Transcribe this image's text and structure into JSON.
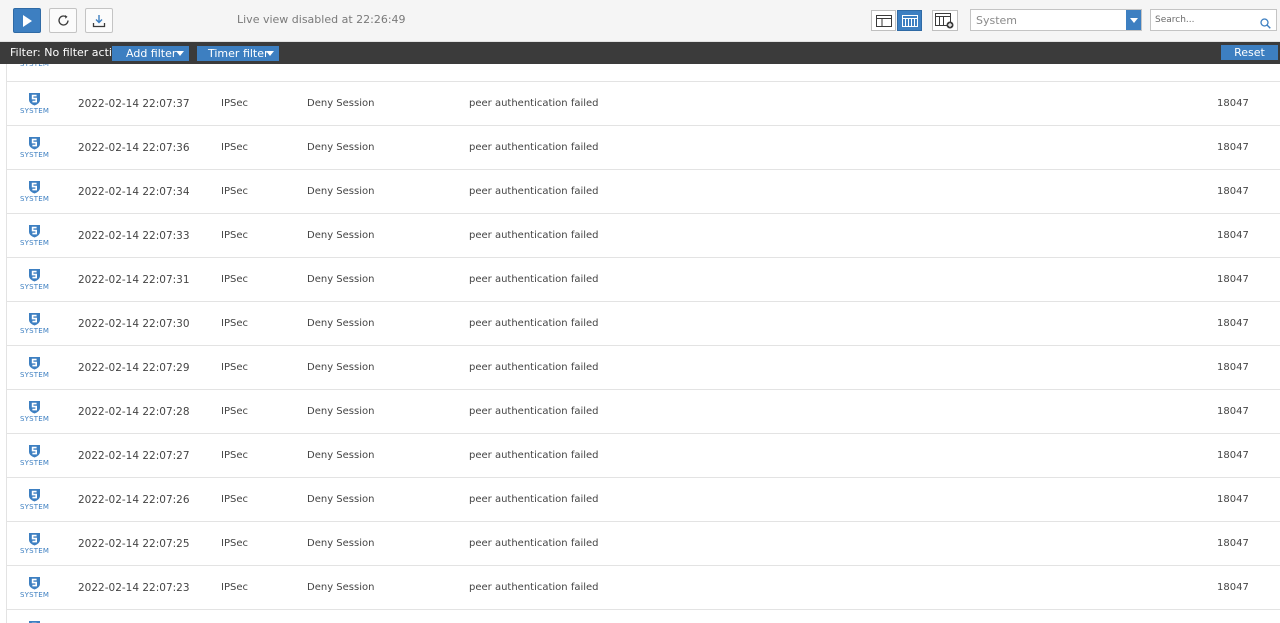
{
  "toolbar": {
    "live_status": "Live view disabled at 22:26:49",
    "icons": {
      "play": "play-icon",
      "refresh": "refresh-icon",
      "download": "download-icon",
      "view_detail": "detail-view-icon",
      "view_grid": "grid-view-icon",
      "column_settings": "column-settings-icon",
      "search": "search-icon"
    },
    "selector": {
      "value": "System"
    },
    "search": {
      "placeholder": "Search..."
    }
  },
  "filterbar": {
    "status": "Filter: No filter active",
    "add_filter": "Add filter",
    "timer_filter": "Timer filter",
    "reset": "Reset"
  },
  "colors": {
    "accent": "#3d7fc1",
    "filterbar_bg": "#3b3b3b"
  },
  "logs": {
    "type_icon": "system-shield-icon",
    "rows": [
      {
        "type": "SYSTEM",
        "time": "2022-02-14 22:07:37",
        "component": "IPSec",
        "action": "Deny Session",
        "message": "peer authentication failed",
        "id": "18047"
      },
      {
        "type": "SYSTEM",
        "time": "2022-02-14 22:07:36",
        "component": "IPSec",
        "action": "Deny Session",
        "message": "peer authentication failed",
        "id": "18047"
      },
      {
        "type": "SYSTEM",
        "time": "2022-02-14 22:07:34",
        "component": "IPSec",
        "action": "Deny Session",
        "message": "peer authentication failed",
        "id": "18047"
      },
      {
        "type": "SYSTEM",
        "time": "2022-02-14 22:07:33",
        "component": "IPSec",
        "action": "Deny Session",
        "message": "peer authentication failed",
        "id": "18047"
      },
      {
        "type": "SYSTEM",
        "time": "2022-02-14 22:07:31",
        "component": "IPSec",
        "action": "Deny Session",
        "message": "peer authentication failed",
        "id": "18047"
      },
      {
        "type": "SYSTEM",
        "time": "2022-02-14 22:07:30",
        "component": "IPSec",
        "action": "Deny Session",
        "message": "peer authentication failed",
        "id": "18047"
      },
      {
        "type": "SYSTEM",
        "time": "2022-02-14 22:07:29",
        "component": "IPSec",
        "action": "Deny Session",
        "message": "peer authentication failed",
        "id": "18047"
      },
      {
        "type": "SYSTEM",
        "time": "2022-02-14 22:07:28",
        "component": "IPSec",
        "action": "Deny Session",
        "message": "peer authentication failed",
        "id": "18047"
      },
      {
        "type": "SYSTEM",
        "time": "2022-02-14 22:07:27",
        "component": "IPSec",
        "action": "Deny Session",
        "message": "peer authentication failed",
        "id": "18047"
      },
      {
        "type": "SYSTEM",
        "time": "2022-02-14 22:07:26",
        "component": "IPSec",
        "action": "Deny Session",
        "message": "peer authentication failed",
        "id": "18047"
      },
      {
        "type": "SYSTEM",
        "time": "2022-02-14 22:07:25",
        "component": "IPSec",
        "action": "Deny Session",
        "message": "peer authentication failed",
        "id": "18047"
      },
      {
        "type": "SYSTEM",
        "time": "2022-02-14 22:07:23",
        "component": "IPSec",
        "action": "Deny Session",
        "message": "peer authentication failed",
        "id": "18047"
      }
    ]
  }
}
